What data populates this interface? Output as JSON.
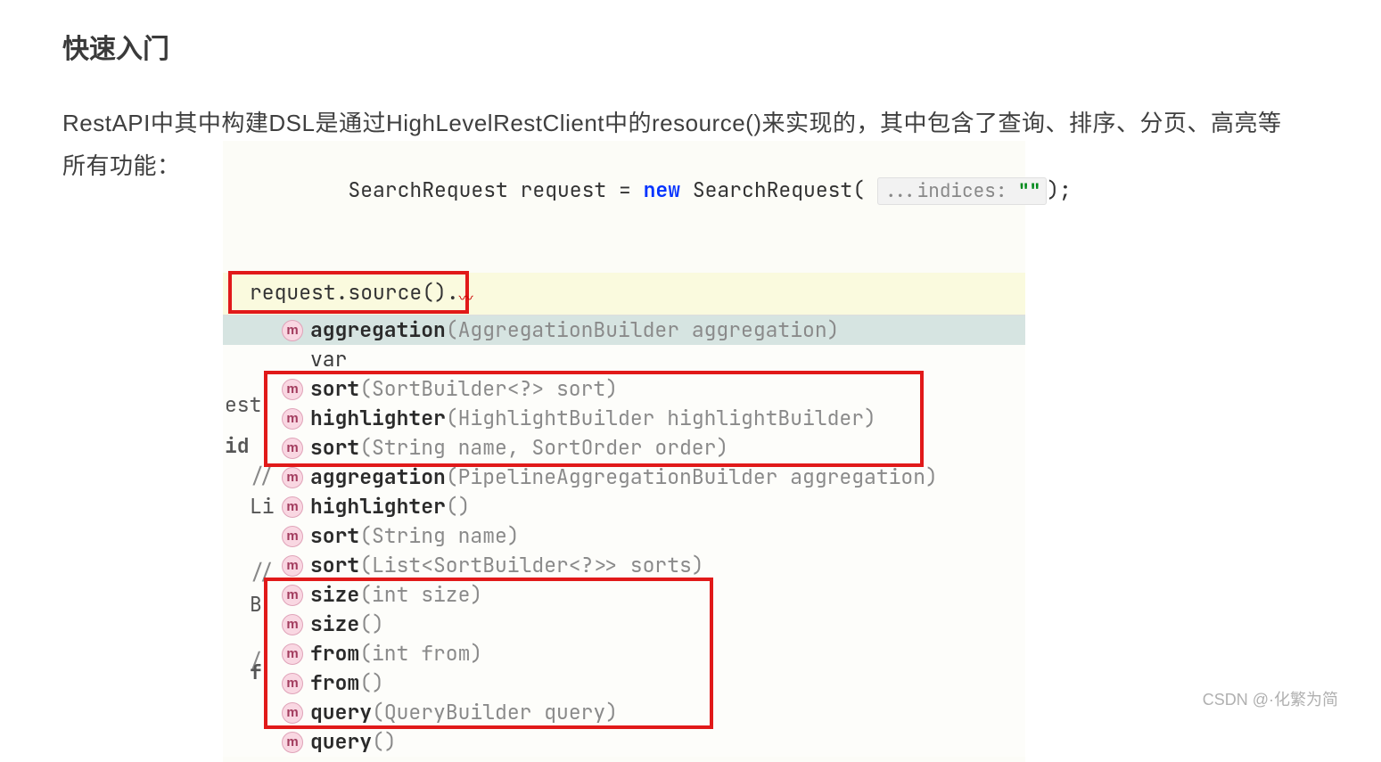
{
  "heading": "快速入门",
  "body_line1": "RestAPI中其中构建DSL是通过HighLevelRestClient中的resource()来实现的，其中包含了查询、排序、分页、高亮等",
  "body_line2_prefix": "所有功能：",
  "code": {
    "decl_pre": "SearchRequest request = ",
    "decl_new": "new",
    "decl_post": " SearchRequest( ",
    "hint": "...indices:",
    "strlit": "\"\"",
    "decl_end": ");",
    "source_call": "request.source()",
    "dot": "."
  },
  "suggestions": [
    {
      "icon": "m",
      "name": "aggregation",
      "params": "(AggregationBuilder aggregation)",
      "selected": true
    },
    {
      "icon": "",
      "name": "var",
      "params": "",
      "var": true
    },
    {
      "icon": "m",
      "name": "sort",
      "params": "(SortBuilder<?> sort)"
    },
    {
      "icon": "m",
      "name": "highlighter",
      "params": "(HighlightBuilder highlightBuilder)"
    },
    {
      "icon": "m",
      "name": "sort",
      "params": "(String name, SortOrder order)"
    },
    {
      "icon": "m",
      "name": "aggregation",
      "params": "(PipelineAggregationBuilder aggregation)"
    },
    {
      "icon": "m",
      "name": "highlighter",
      "params": "()"
    },
    {
      "icon": "m",
      "name": "sort",
      "params": "(String name)"
    },
    {
      "icon": "m",
      "name": "sort",
      "params": "(List<SortBuilder<?>> sorts)"
    },
    {
      "icon": "m",
      "name": "size",
      "params": "(int size)"
    },
    {
      "icon": "m",
      "name": "size",
      "params": "()"
    },
    {
      "icon": "m",
      "name": "from",
      "params": "(int from)"
    },
    {
      "icon": "m",
      "name": "from",
      "params": "()"
    },
    {
      "icon": "m",
      "name": "query",
      "params": "(QueryBuilder query)"
    },
    {
      "icon": "m",
      "name": "query",
      "params": "()"
    }
  ],
  "behind": {
    "est": "est",
    "id": "id",
    "sl1": "//",
    "li": "Li",
    "sl2": "//",
    "b": "B",
    "sl3": "/",
    "f": "f"
  },
  "watermark": "CSDN @·化繁为简"
}
